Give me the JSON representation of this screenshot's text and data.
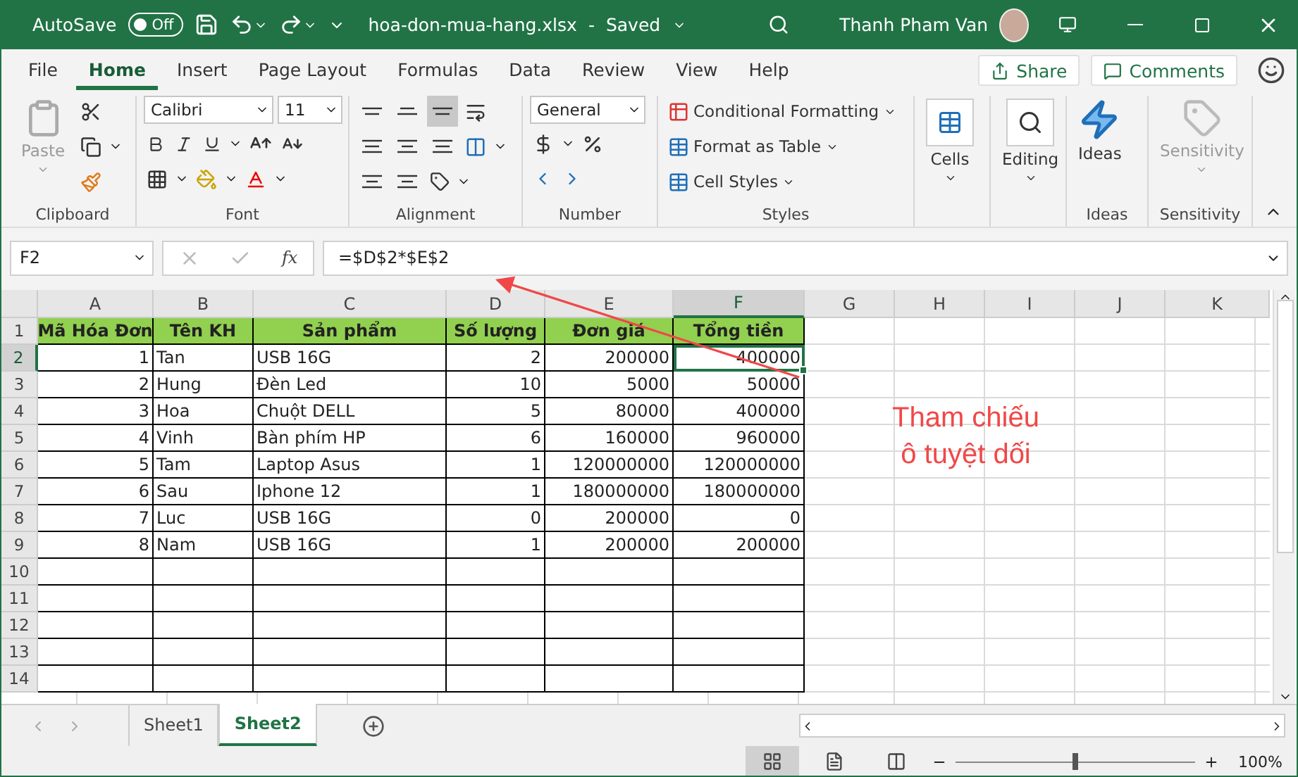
{
  "title_bar": {
    "autosave_label": "AutoSave",
    "autosave_toggle": {
      "label": "Off",
      "on": false
    },
    "filename": "hoa-don-mua-hang.xlsx",
    "separator": "-",
    "status": "Saved",
    "user": "Thanh Pham Van"
  },
  "menu_tabs": [
    {
      "label": "File",
      "selected": false
    },
    {
      "label": "Home",
      "selected": true
    },
    {
      "label": "Insert",
      "selected": false
    },
    {
      "label": "Page Layout",
      "selected": false
    },
    {
      "label": "Formulas",
      "selected": false
    },
    {
      "label": "Data",
      "selected": false
    },
    {
      "label": "Review",
      "selected": false
    },
    {
      "label": "View",
      "selected": false
    },
    {
      "label": "Help",
      "selected": false
    }
  ],
  "share_button": "Share",
  "comments_button": "Comments",
  "ribbon": {
    "clipboard": {
      "paste": "Paste",
      "label": "Clipboard"
    },
    "font": {
      "font_name": "Calibri",
      "font_size": "11",
      "label": "Font"
    },
    "alignment": {
      "vertical": [
        {
          "selected": false
        },
        {
          "selected": false
        },
        {
          "selected": true
        }
      ],
      "label": "Alignment"
    },
    "number": {
      "format": "General",
      "label": "Number"
    },
    "styles": {
      "items": [
        "Conditional Formatting",
        "Format as Table",
        "Cell Styles"
      ],
      "label": "Styles"
    },
    "cells": {
      "button": "Cells"
    },
    "editing": {
      "button": "Editing"
    },
    "ideas": {
      "button": "Ideas",
      "label": "Ideas"
    },
    "sensitivity": {
      "button": "Sensitivity",
      "disabled": true,
      "label": "Sensitivity"
    }
  },
  "formula_bar": {
    "name_box": "F2",
    "fx": "fx",
    "formula": "=$D$2*$E$2"
  },
  "sheet": {
    "columns": [
      {
        "label": "A",
        "selected": false
      },
      {
        "label": "B",
        "selected": false
      },
      {
        "label": "C",
        "selected": false
      },
      {
        "label": "D",
        "selected": false
      },
      {
        "label": "E",
        "selected": false
      },
      {
        "label": "F",
        "selected": true
      },
      {
        "label": "G",
        "selected": false
      },
      {
        "label": "H",
        "selected": false
      },
      {
        "label": "I",
        "selected": false
      },
      {
        "label": "J",
        "selected": false
      },
      {
        "label": "K",
        "selected": false
      }
    ],
    "header_row": {
      "number": "1",
      "cells": [
        "Mã Hóa Đơn",
        "Tên KH",
        "Sản phẩm",
        "Số lượng",
        "Đơn giá",
        "Tổng tiền"
      ]
    },
    "rows": [
      {
        "number": "2",
        "selected": true,
        "cells": [
          "1",
          "Tan",
          "USB 16G",
          "2",
          "200000",
          "400000"
        ]
      },
      {
        "number": "3",
        "selected": false,
        "cells": [
          "2",
          "Hung",
          "Đèn Led",
          "10",
          "5000",
          "50000"
        ]
      },
      {
        "number": "4",
        "selected": false,
        "cells": [
          "3",
          "Hoa",
          "Chuột DELL",
          "5",
          "80000",
          "400000"
        ]
      },
      {
        "number": "5",
        "selected": false,
        "cells": [
          "4",
          "Vinh",
          "Bàn phím HP",
          "6",
          "160000",
          "960000"
        ]
      },
      {
        "number": "6",
        "selected": false,
        "cells": [
          "5",
          "Tam",
          "Laptop Asus",
          "1",
          "120000000",
          "120000000"
        ]
      },
      {
        "number": "7",
        "selected": false,
        "cells": [
          "6",
          "Sau",
          "Iphone 12",
          "1",
          "180000000",
          "180000000"
        ]
      },
      {
        "number": "8",
        "selected": false,
        "cells": [
          "7",
          "Luc",
          "USB 16G",
          "0",
          "200000",
          "0"
        ]
      },
      {
        "number": "9",
        "selected": false,
        "cells": [
          "8",
          "Nam",
          "USB 16G",
          "1",
          "200000",
          "200000"
        ]
      },
      {
        "number": "10",
        "selected": false
      },
      {
        "number": "11",
        "selected": false
      },
      {
        "number": "12",
        "selected": false
      },
      {
        "number": "13",
        "selected": false
      },
      {
        "number": "14",
        "selected": false
      }
    ]
  },
  "annotation": "Tham chiếu\nô tuyệt dối",
  "sheet_tabs": [
    {
      "label": "Sheet1",
      "selected": false
    },
    {
      "label": "Sheet2",
      "selected": true
    }
  ],
  "status_bar": {
    "views": [
      {
        "selected": true
      },
      {
        "selected": false
      },
      {
        "selected": false
      }
    ],
    "zoom": {
      "level": 0.5,
      "reading": "100%"
    }
  }
}
